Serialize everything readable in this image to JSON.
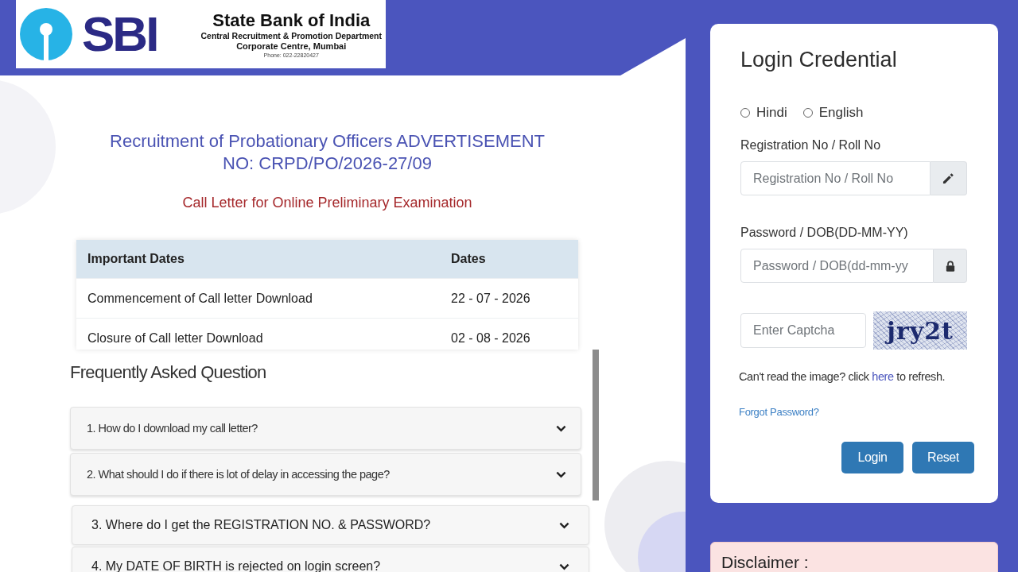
{
  "header": {
    "logo_text": "SBI",
    "bank_name": "State Bank of India",
    "department": "Central Recruitment & Promotion Department",
    "office": "Corporate Centre, Mumbai",
    "phone": "Phone: 022-22820427"
  },
  "notice": {
    "title_lines": [
      "Recruitment of Probationary Officers ADVERTISEMENT",
      "NO: CRPD/PO/2026-27/09"
    ],
    "subtitle": "Call Letter for Online Preliminary Examination"
  },
  "dates_table": {
    "columns": [
      "Important Dates",
      "Dates"
    ],
    "rows": [
      [
        "Commencement of Call letter Download",
        "22 - 07 - 2026"
      ],
      [
        "Closure of Call letter Download",
        "02 - 08 - 2026"
      ]
    ]
  },
  "faq": {
    "title": "Frequently Asked Question",
    "items": [
      {
        "question": "1. How do I download my call letter?",
        "expanded": false
      },
      {
        "question": "2. What should I do if there is lot of delay in accessing the page?",
        "expanded": false
      }
    ]
  },
  "faq_continued": {
    "items": [
      {
        "question": "3. Where do I get the REGISTRATION NO. & PASSWORD?",
        "expanded": false
      },
      {
        "question": "4. My DATE OF BIRTH is rejected on login screen?",
        "expanded": false
      }
    ]
  },
  "login": {
    "title": "Login Credential",
    "languages": [
      {
        "label": "Hindi",
        "selected": false
      },
      {
        "label": "English",
        "selected": false
      }
    ],
    "fields": [
      {
        "label": "Registration No / Roll No",
        "placeholder": "Registration No / Roll No",
        "kind": "edit"
      },
      {
        "label": "Password / DOB(DD-MM-YY)",
        "placeholder": "Password / DOB(dd-mm-yy",
        "kind": "lock"
      }
    ],
    "captcha": {
      "placeholder": "Enter Captcha",
      "text": "jry2t"
    },
    "refresh_hint": {
      "before": "Can't read the image? click",
      "link": "here",
      "after": "to refresh."
    },
    "forgot_link": "Forgot Password?",
    "buttons": [
      "Login",
      "Reset"
    ]
  },
  "disclaimer": {
    "title": "Disclaimer :"
  }
}
